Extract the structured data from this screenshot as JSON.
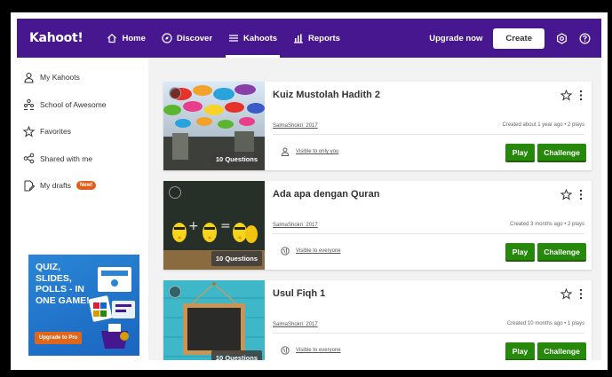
{
  "nav": {
    "logo": "Kahoot!",
    "home": "Home",
    "discover": "Discover",
    "kahoots": "Kahoots",
    "reports": "Reports",
    "upgrade": "Upgrade now",
    "create": "Create"
  },
  "sidebar": {
    "items": [
      {
        "label": "My Kahoots",
        "icon": "user-icon"
      },
      {
        "label": "School of Awesome",
        "icon": "group-icon"
      },
      {
        "label": "Favorites",
        "icon": "star-icon"
      },
      {
        "label": "Shared with me",
        "icon": "share-icon"
      },
      {
        "label": "My drafts",
        "icon": "drafts-icon",
        "badge": "New!"
      }
    ],
    "promo": {
      "line1": "QUIZ,",
      "line2": "SLIDES,",
      "line3": "POLLS - IN",
      "line4": "ONE GAME!",
      "button": "Upgrade to Pro"
    }
  },
  "kahoots": [
    {
      "title": "Kuiz Mustolah Hadith 2",
      "owner": "SalmaShokri_2017",
      "meta": "Created about 1 year ago • 2 plays",
      "questions": "10 Questions",
      "visibility": "Visible to only you",
      "play": "Play",
      "challenge": "Challenge"
    },
    {
      "title": "Ada apa dengan Quran",
      "owner": "SalmaShokri_2017",
      "meta": "Created 3 months ago • 2 plays",
      "questions": "10 Questions",
      "visibility": "Visible to everyone",
      "play": "Play",
      "challenge": "Challenge"
    },
    {
      "title": "Usul Fiqh 1",
      "owner": "SalmaShokri_2017",
      "meta": "Created 10 months ago • 1 plays",
      "questions": "10 Questions",
      "visibility": "Visible to everyone",
      "play": "Play",
      "challenge": "Challenge"
    }
  ],
  "colors": {
    "brand": "#46178f",
    "play_green": "#26890c",
    "badge_orange": "#e05d1b"
  }
}
